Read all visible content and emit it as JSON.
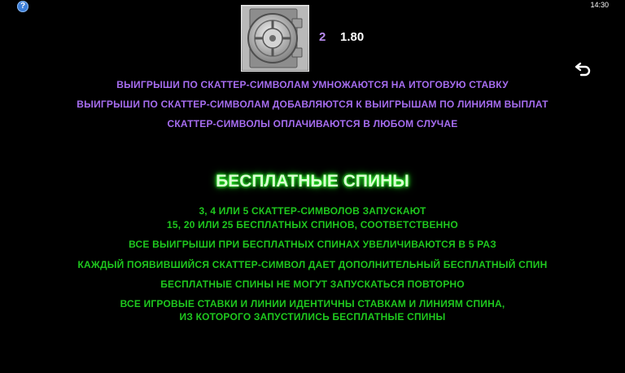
{
  "top_bar": {
    "help_label": "?",
    "time": "14:30"
  },
  "paytable": {
    "symbol_icon": "vault-door-icon",
    "count": "2",
    "multiplier": "1.80"
  },
  "scatter_rules": [
    "ВЫИГРЫШИ ПО СКАТТЕР-СИМВОЛАМ УМНОЖАЮТСЯ НА ИТОГОВУЮ СТАВКУ",
    "ВЫИГРЫШИ ПО СКАТТЕР-СИМВОЛАМ ДОБАВЛЯЮТСЯ К ВЫИГРЫШАМ ПО ЛИНИЯМ ВЫПЛАТ",
    "СКАТТЕР-СИМВОЛЫ ОПЛАЧИВАЮТСЯ В ЛЮБОМ СЛУЧАЕ"
  ],
  "free_spins": {
    "heading": "БЕСПЛАТНЫЕ СПИНЫ",
    "rules": [
      "3, 4 ИЛИ 5 СКАТТЕР-СИМВОЛОВ ЗАПУСКАЮТ",
      "15, 20 ИЛИ 25 БЕСПЛАТНЫХ СПИНОВ, СООТВЕТСТВЕННО",
      "ВСЕ ВЫИГРЫШИ ПРИ БЕСПЛАТНЫХ СПИНАХ УВЕЛИЧИВАЮТСЯ В 5 РАЗ",
      "КАЖДЫЙ ПОЯВИВШИЙСЯ СКАТТЕР-СИМВОЛ ДАЕТ ДОПОЛНИТЕЛЬНЫЙ БЕСПЛАТНЫЙ СПИН",
      "БЕСПЛАТНЫЕ СПИНЫ НЕ МОГУТ ЗАПУСКАТЬСЯ ПОВТОРНО",
      "ВСЕ ИГРОВЫЕ СТАВКИ И ЛИНИИ ИДЕНТИЧНЫ СТАВКАМ И ЛИНИЯМ СПИНА,",
      "ИЗ КОТОРОГО ЗАПУСТИЛИСЬ БЕСПЛАТНЫЕ СПИНЫ"
    ]
  },
  "colors": {
    "background": "#000000",
    "scatter_text": "#a66df0",
    "free_spins_text": "#1ec81e",
    "heading_glow": "#22dd22",
    "count_text": "#b98cf0"
  }
}
